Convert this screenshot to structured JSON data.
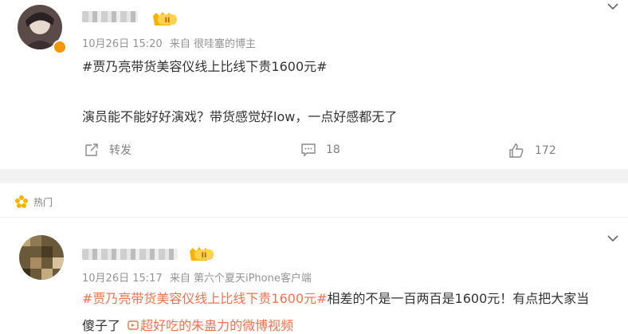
{
  "post": {
    "author_name": "",
    "time": "10月26日 15:20",
    "source": "来自 很哇塞的博主",
    "topic": "#贾乃亮带货美容仪线上比线下贵1600元#",
    "content": "演员能不能好好演戏？带货感觉好low，一点好感都无了",
    "actions": {
      "repost": "转发",
      "comment": "18",
      "like": "172"
    },
    "badge": "II"
  },
  "hot_comment": {
    "section_label": "热门",
    "author_name": "",
    "time": "10月26日 15:17",
    "source": "来自 第六个夏天iPhone客户端",
    "topic": "#贾乃亮带货美容仪线上比线下贵1600元#",
    "text_rest": "相差的不是一百两百是1600元！有点把大家当",
    "text_line2": "傻子了",
    "video_link": "超好吃的朱蛊力的微博视频",
    "badge": "II"
  },
  "colors": {
    "accent": "#eb7350",
    "meta": "#939393",
    "vip": "#f39800"
  }
}
